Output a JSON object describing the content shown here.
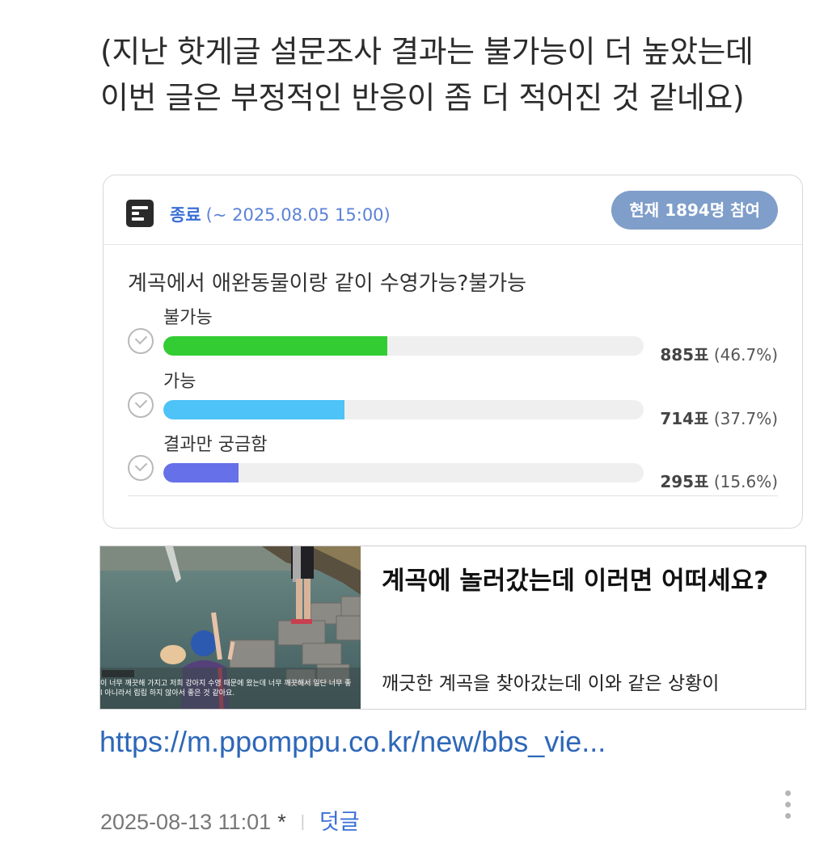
{
  "intro": {
    "line1": "(지난 핫게글 설문조사 결과는 불가능이 더 높았는데",
    "line2": "이번 글은 부정적인 반응이 좀 더 적어진 것 같네요)"
  },
  "poll": {
    "status": "종료",
    "period": "(~ 2025.08.05 15:00)",
    "participants": "현재 1894명 참여",
    "question": "계곡에서 애완동물이랑 같이 수영가능?불가능",
    "options": [
      {
        "label": "불가능",
        "votes": "885표",
        "percent": "(46.7%)",
        "ratio": 0.467,
        "color": "#33cc33"
      },
      {
        "label": "가능",
        "votes": "714표",
        "percent": "(37.7%)",
        "ratio": 0.377,
        "color": "#4ec3f7"
      },
      {
        "label": "결과만 궁금함",
        "votes": "295표",
        "percent": "(15.6%)",
        "ratio": 0.156,
        "color": "#6670e8"
      }
    ]
  },
  "link_preview": {
    "title": "계곡에 놀러갔는데 이러면 어떠세요?",
    "description": "깨긋한 계곡을 찾아갔는데 이와 같은 상황이",
    "thumbnail_caption_1": "이 너무 깨끗해 가지고 저희 강아지 수영 때문에 왔는데 너무 깨끗해서 일단 너무 좋",
    "thumbnail_caption_2": "l 아니라서 립립 하지 않아서 좋은 것 같아요."
  },
  "url": "https://m.ppomppu.co.kr/new/bbs_vie...",
  "meta": {
    "timestamp": "2025-08-13 11:01",
    "star": "*",
    "separator": "|",
    "reply_label": "덧글"
  }
}
